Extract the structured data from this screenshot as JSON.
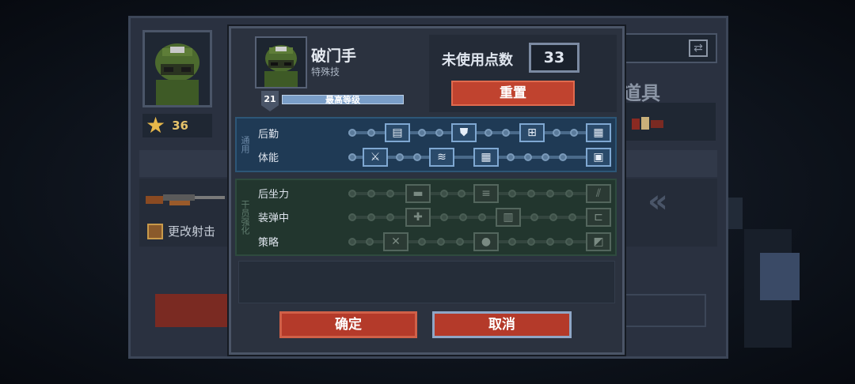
{
  "background": {
    "star_count": "36",
    "items_title": "道具",
    "change_text": "更改射击"
  },
  "character": {
    "name": "破门手",
    "subtitle": "特殊技",
    "level": "21",
    "level_text": "最高等级"
  },
  "points": {
    "label": "未使用点数",
    "value": "33",
    "reset_label": "重置"
  },
  "section_general": {
    "tab": "通用",
    "rows": [
      {
        "label": "后勤"
      },
      {
        "label": "体能"
      }
    ]
  },
  "section_weapon": {
    "tab": "干员强化",
    "rows": [
      {
        "label": "后坐力"
      },
      {
        "label": "装弹中"
      },
      {
        "label": "策略"
      }
    ]
  },
  "buttons": {
    "confirm": "确定",
    "cancel": "取消"
  },
  "colors": {
    "accent_red": "#c0432f",
    "active_blue": "#1f3a55",
    "inactive_green": "#22362e"
  }
}
